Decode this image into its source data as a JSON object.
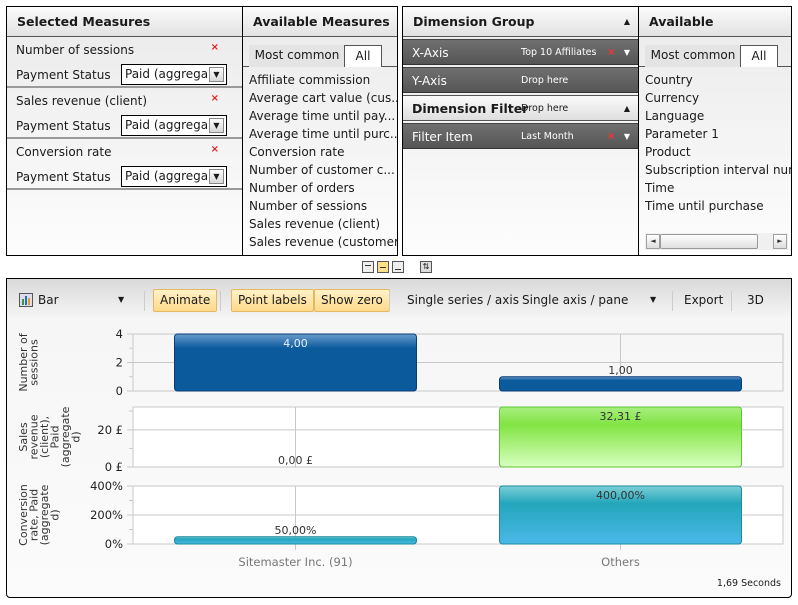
{
  "selected_measures": {
    "title": "Selected Measures",
    "items": [
      {
        "name": "Number of sessions",
        "filter_label": "Payment Status",
        "filter_value": "Paid (aggrega"
      },
      {
        "name": "Sales revenue (client)",
        "filter_label": "Payment Status",
        "filter_value": "Paid (aggrega"
      },
      {
        "name": "Conversion rate",
        "filter_label": "Payment Status",
        "filter_value": "Paid (aggrega"
      }
    ],
    "remove_glyph": "×",
    "dropdown_glyph": "▼"
  },
  "available_measures": {
    "title": "Available Measures",
    "tabs": [
      "Most common",
      "All"
    ],
    "items": [
      "Affiliate commission",
      "Average cart value (cus...",
      "Average time until pay...",
      "Average time until purc...",
      "Conversion rate",
      "Number of customer c...",
      "Number of orders",
      "Number of sessions",
      "Sales revenue (client)",
      "Sales revenue (customer)"
    ]
  },
  "dimension_group": {
    "title": "Dimension Group",
    "x_axis": {
      "label": "X-Axis",
      "value": "Top 10 Affiliates"
    },
    "y_axis": {
      "label": "Y-Axis",
      "value": "Drop here"
    },
    "filter_title": "Dimension Filter",
    "filter_drop": "Drop here",
    "filter_item": {
      "label": "Filter Item",
      "value": "Last Month"
    },
    "collapse_glyph": "▲",
    "dropdown_glyph": "▼",
    "remove_glyph": "×"
  },
  "available_dimensions": {
    "title": "Available Dimensions",
    "tabs": [
      "Most common",
      "All"
    ],
    "items": [
      "Country",
      "Currency",
      "Language",
      "Parameter 1",
      "Product",
      "Subscription interval numbe",
      "Time",
      "Time until purchase"
    ],
    "scroll_left": "◄",
    "scroll_right": "►"
  },
  "layout_buttons": {
    "swap_glyph": "⇅"
  },
  "toolbar": {
    "chart_type": "Bar",
    "dropdown_glyph": "▼",
    "animate": "Animate",
    "point_labels": "Point labels",
    "show_zero": "Show zero",
    "series_mode": "Single series / axis",
    "axis_mode": "Single axis / pane",
    "export": "Export",
    "three_d": "3D"
  },
  "timing": "1,69 Seconds",
  "colors": {
    "sessions_bar": "#0b5a9c",
    "revenue_bar": "#7fe040",
    "conversion_bar": "#2aa8c4",
    "toggle_active": "#ffd98a"
  },
  "chart_data": {
    "type": "bar",
    "categories": [
      "Sitemaster Inc. (91)",
      "Others"
    ],
    "panes": [
      {
        "ylabel": "Number of sessions",
        "values": [
          4.0,
          1.0
        ],
        "labels": [
          "4,00",
          "1,00"
        ],
        "ylim": [
          0,
          4
        ],
        "ticks": [
          "0",
          "2",
          "4"
        ],
        "tick_values": [
          0,
          2,
          4
        ],
        "color": "#0b5a9c"
      },
      {
        "ylabel": "Sales revenue (client), Paid (aggregated)",
        "ylabel_lines": [
          "Sales",
          "revenue",
          "(client),",
          "Paid",
          "(aggregate",
          "d)"
        ],
        "values": [
          0.0,
          32.31
        ],
        "labels": [
          "0,00 £",
          "32,31 £"
        ],
        "ylim": [
          0,
          32.31
        ],
        "ticks": [
          "0 £",
          "20 £"
        ],
        "tick_values": [
          0,
          20
        ],
        "color": "#7fe040"
      },
      {
        "ylabel": "Conversion rate, Paid (aggregated)",
        "ylabel_lines": [
          "Conversion",
          "rate, Paid",
          "(aggregate",
          "d)"
        ],
        "values": [
          50.0,
          400.0
        ],
        "labels": [
          "50,00%",
          "400,00%"
        ],
        "ylim": [
          0,
          400
        ],
        "ticks": [
          "0%",
          "200%",
          "400%"
        ],
        "tick_values": [
          0,
          200,
          400
        ],
        "color": "#2aa8c4"
      }
    ],
    "grid": true,
    "legend": "none"
  }
}
